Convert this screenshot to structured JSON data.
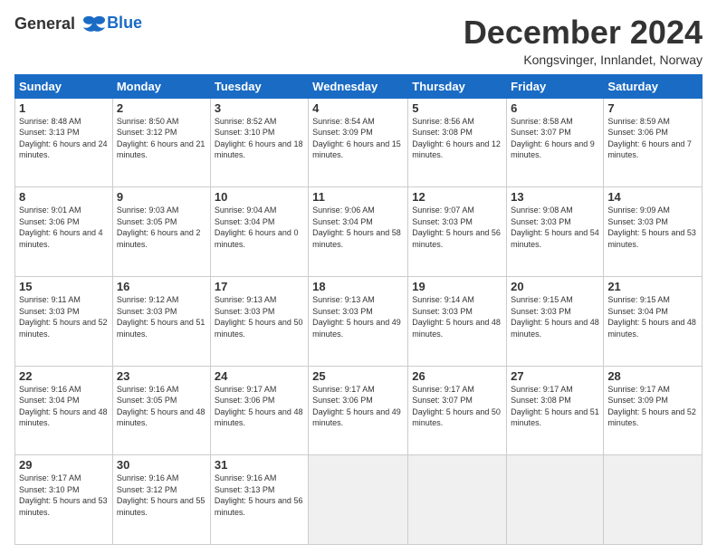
{
  "header": {
    "logo_line1": "General",
    "logo_line2": "Blue",
    "title": "December 2024",
    "subtitle": "Kongsvinger, Innlandet, Norway"
  },
  "weekdays": [
    "Sunday",
    "Monday",
    "Tuesday",
    "Wednesday",
    "Thursday",
    "Friday",
    "Saturday"
  ],
  "weeks": [
    [
      {
        "day": "1",
        "sunrise": "Sunrise: 8:48 AM",
        "sunset": "Sunset: 3:13 PM",
        "daylight": "Daylight: 6 hours and 24 minutes."
      },
      {
        "day": "2",
        "sunrise": "Sunrise: 8:50 AM",
        "sunset": "Sunset: 3:12 PM",
        "daylight": "Daylight: 6 hours and 21 minutes."
      },
      {
        "day": "3",
        "sunrise": "Sunrise: 8:52 AM",
        "sunset": "Sunset: 3:10 PM",
        "daylight": "Daylight: 6 hours and 18 minutes."
      },
      {
        "day": "4",
        "sunrise": "Sunrise: 8:54 AM",
        "sunset": "Sunset: 3:09 PM",
        "daylight": "Daylight: 6 hours and 15 minutes."
      },
      {
        "day": "5",
        "sunrise": "Sunrise: 8:56 AM",
        "sunset": "Sunset: 3:08 PM",
        "daylight": "Daylight: 6 hours and 12 minutes."
      },
      {
        "day": "6",
        "sunrise": "Sunrise: 8:58 AM",
        "sunset": "Sunset: 3:07 PM",
        "daylight": "Daylight: 6 hours and 9 minutes."
      },
      {
        "day": "7",
        "sunrise": "Sunrise: 8:59 AM",
        "sunset": "Sunset: 3:06 PM",
        "daylight": "Daylight: 6 hours and 7 minutes."
      }
    ],
    [
      {
        "day": "8",
        "sunrise": "Sunrise: 9:01 AM",
        "sunset": "Sunset: 3:06 PM",
        "daylight": "Daylight: 6 hours and 4 minutes."
      },
      {
        "day": "9",
        "sunrise": "Sunrise: 9:03 AM",
        "sunset": "Sunset: 3:05 PM",
        "daylight": "Daylight: 6 hours and 2 minutes."
      },
      {
        "day": "10",
        "sunrise": "Sunrise: 9:04 AM",
        "sunset": "Sunset: 3:04 PM",
        "daylight": "Daylight: 6 hours and 0 minutes."
      },
      {
        "day": "11",
        "sunrise": "Sunrise: 9:06 AM",
        "sunset": "Sunset: 3:04 PM",
        "daylight": "Daylight: 5 hours and 58 minutes."
      },
      {
        "day": "12",
        "sunrise": "Sunrise: 9:07 AM",
        "sunset": "Sunset: 3:03 PM",
        "daylight": "Daylight: 5 hours and 56 minutes."
      },
      {
        "day": "13",
        "sunrise": "Sunrise: 9:08 AM",
        "sunset": "Sunset: 3:03 PM",
        "daylight": "Daylight: 5 hours and 54 minutes."
      },
      {
        "day": "14",
        "sunrise": "Sunrise: 9:09 AM",
        "sunset": "Sunset: 3:03 PM",
        "daylight": "Daylight: 5 hours and 53 minutes."
      }
    ],
    [
      {
        "day": "15",
        "sunrise": "Sunrise: 9:11 AM",
        "sunset": "Sunset: 3:03 PM",
        "daylight": "Daylight: 5 hours and 52 minutes."
      },
      {
        "day": "16",
        "sunrise": "Sunrise: 9:12 AM",
        "sunset": "Sunset: 3:03 PM",
        "daylight": "Daylight: 5 hours and 51 minutes."
      },
      {
        "day": "17",
        "sunrise": "Sunrise: 9:13 AM",
        "sunset": "Sunset: 3:03 PM",
        "daylight": "Daylight: 5 hours and 50 minutes."
      },
      {
        "day": "18",
        "sunrise": "Sunrise: 9:13 AM",
        "sunset": "Sunset: 3:03 PM",
        "daylight": "Daylight: 5 hours and 49 minutes."
      },
      {
        "day": "19",
        "sunrise": "Sunrise: 9:14 AM",
        "sunset": "Sunset: 3:03 PM",
        "daylight": "Daylight: 5 hours and 48 minutes."
      },
      {
        "day": "20",
        "sunrise": "Sunrise: 9:15 AM",
        "sunset": "Sunset: 3:03 PM",
        "daylight": "Daylight: 5 hours and 48 minutes."
      },
      {
        "day": "21",
        "sunrise": "Sunrise: 9:15 AM",
        "sunset": "Sunset: 3:04 PM",
        "daylight": "Daylight: 5 hours and 48 minutes."
      }
    ],
    [
      {
        "day": "22",
        "sunrise": "Sunrise: 9:16 AM",
        "sunset": "Sunset: 3:04 PM",
        "daylight": "Daylight: 5 hours and 48 minutes."
      },
      {
        "day": "23",
        "sunrise": "Sunrise: 9:16 AM",
        "sunset": "Sunset: 3:05 PM",
        "daylight": "Daylight: 5 hours and 48 minutes."
      },
      {
        "day": "24",
        "sunrise": "Sunrise: 9:17 AM",
        "sunset": "Sunset: 3:06 PM",
        "daylight": "Daylight: 5 hours and 48 minutes."
      },
      {
        "day": "25",
        "sunrise": "Sunrise: 9:17 AM",
        "sunset": "Sunset: 3:06 PM",
        "daylight": "Daylight: 5 hours and 49 minutes."
      },
      {
        "day": "26",
        "sunrise": "Sunrise: 9:17 AM",
        "sunset": "Sunset: 3:07 PM",
        "daylight": "Daylight: 5 hours and 50 minutes."
      },
      {
        "day": "27",
        "sunrise": "Sunrise: 9:17 AM",
        "sunset": "Sunset: 3:08 PM",
        "daylight": "Daylight: 5 hours and 51 minutes."
      },
      {
        "day": "28",
        "sunrise": "Sunrise: 9:17 AM",
        "sunset": "Sunset: 3:09 PM",
        "daylight": "Daylight: 5 hours and 52 minutes."
      }
    ],
    [
      {
        "day": "29",
        "sunrise": "Sunrise: 9:17 AM",
        "sunset": "Sunset: 3:10 PM",
        "daylight": "Daylight: 5 hours and 53 minutes."
      },
      {
        "day": "30",
        "sunrise": "Sunrise: 9:16 AM",
        "sunset": "Sunset: 3:12 PM",
        "daylight": "Daylight: 5 hours and 55 minutes."
      },
      {
        "day": "31",
        "sunrise": "Sunrise: 9:16 AM",
        "sunset": "Sunset: 3:13 PM",
        "daylight": "Daylight: 5 hours and 56 minutes."
      },
      null,
      null,
      null,
      null
    ]
  ]
}
